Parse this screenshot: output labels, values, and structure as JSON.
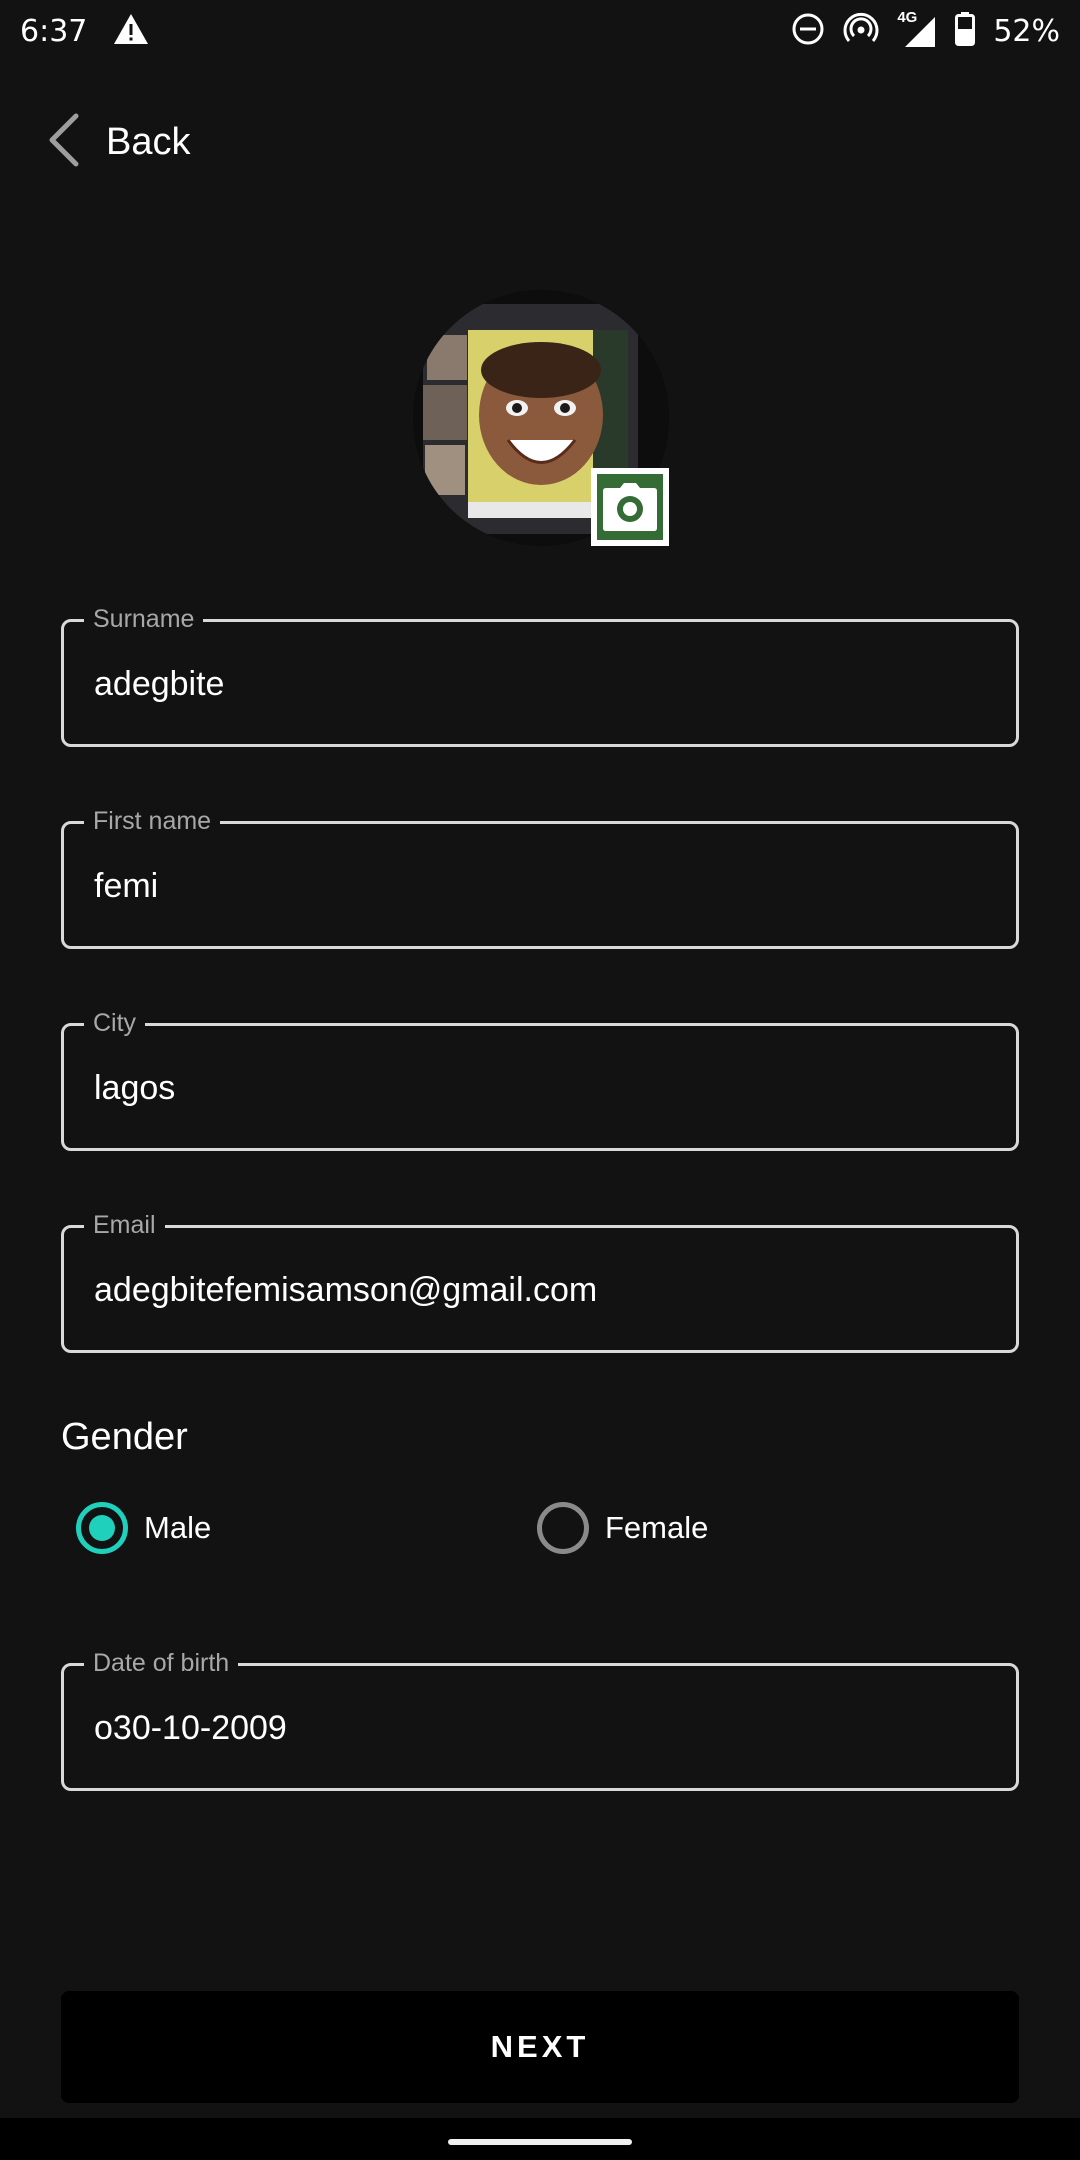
{
  "status_bar": {
    "time": "6:37",
    "battery_percent": "52%",
    "network": "4G",
    "icons": [
      "warning-icon",
      "do-not-disturb-icon",
      "hotspot-icon",
      "signal-icon",
      "battery-icon"
    ]
  },
  "header": {
    "back_label": "Back",
    "back_icon": "chevron-left-icon"
  },
  "profile": {
    "avatar_icon": "profile-photo",
    "change_photo_icon": "camera-icon",
    "badge_color": "#356b35"
  },
  "form": {
    "surname": {
      "label": "Surname",
      "value": "adegbite"
    },
    "first_name": {
      "label": "First name",
      "value": "femi"
    },
    "city": {
      "label": "City",
      "value": "lagos"
    },
    "email": {
      "label": "Email",
      "value": "adegbitefemisamson@gmail.com"
    },
    "gender": {
      "title": "Gender",
      "options": [
        {
          "label": "Male",
          "selected": true
        },
        {
          "label": "Female",
          "selected": false
        }
      ],
      "accent_color": "#1fd1bd"
    },
    "dob": {
      "label": "Date of birth",
      "value": "o30-10-2009"
    }
  },
  "actions": {
    "next_label": "NEXT"
  }
}
